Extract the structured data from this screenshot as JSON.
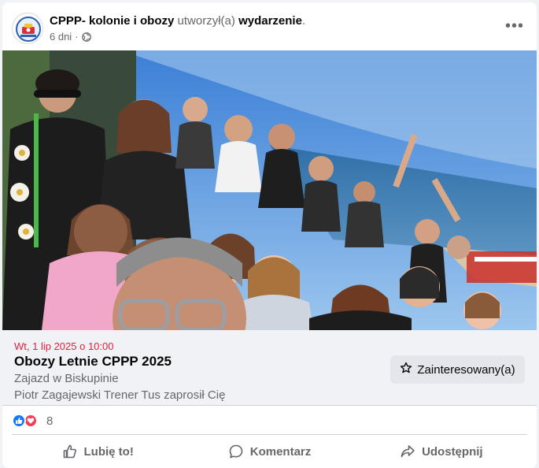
{
  "post": {
    "author_name": "CPPP- kolonie i obozy",
    "action_text": "utworzył(a)",
    "action_target": "wydarzenie",
    "action_end": ".",
    "time_ago": "6 dni",
    "separator": "·",
    "more_label": "•••",
    "privacy_icon": "globe-icon"
  },
  "event": {
    "date": "Wt, 1 lip 2025 o 10:00",
    "title": "Obozy Letnie CPPP 2025",
    "location": "Zajazd w Biskupinie",
    "invite": "Piotr Zagajewski Trener Tus zaprosił Cię",
    "interested_label": "Zainteresowany(a)",
    "interested_icon": "star-icon"
  },
  "reactions": {
    "count": "8",
    "icons": [
      "like-reaction-icon",
      "love-reaction-icon"
    ]
  },
  "actions": {
    "like_label": "Lubię to!",
    "comment_label": "Komentarz",
    "share_label": "Udostępnij"
  },
  "colors": {
    "date_red": "#e41e3f",
    "like_blue": "#1877f2",
    "love_red": "#f33e58",
    "secondary_text": "#65676b",
    "button_bg": "#e4e6eb"
  }
}
